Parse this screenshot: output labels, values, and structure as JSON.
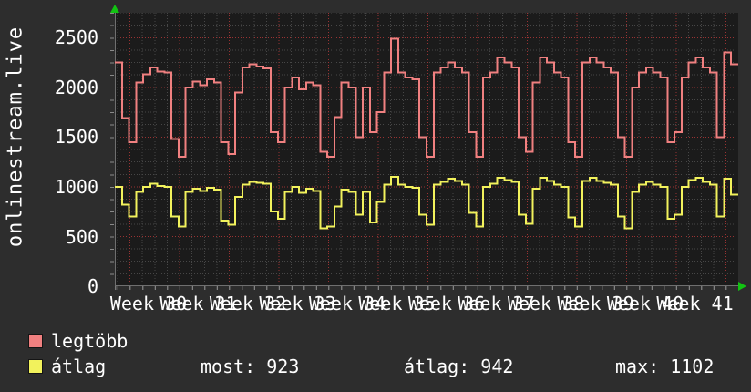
{
  "graph": {
    "vertical_title": "onlinestream.live"
  },
  "legend": {
    "series1_label": "legtöbb",
    "series2_label": "átlag",
    "stats": [
      "most: 923",
      "átlag: 942",
      "max: 1102"
    ]
  },
  "colors": {
    "background": "#2d2d2d",
    "plot_background": "#1b1b1b",
    "grid_minor": "#474747",
    "grid_major": "#993333",
    "axis": "#6f6f6f",
    "arrow": "#12c312",
    "text": "#ffffff",
    "series1": "#f08080",
    "series2": "#f2f25c"
  },
  "chart_data": {
    "type": "line",
    "style": "step-daily",
    "title": "onlinestream.live",
    "x_labels": [
      "Week 30",
      "Week 31",
      "Week 32",
      "Week 33",
      "Week 34",
      "Week 35",
      "Week 36",
      "Week 37",
      "Week 38",
      "Week 39",
      "Week 40",
      "Week 41"
    ],
    "y_ticks": [
      0,
      500,
      1000,
      1500,
      2000,
      2500
    ],
    "ylim": [
      0,
      2750
    ],
    "grid": true,
    "legend_position": "bottom-left",
    "stats": {
      "most": 923,
      "átlag": 942,
      "max": 1102
    },
    "series": [
      {
        "name": "legtöbb",
        "color": "#f08080",
        "values": [
          2250,
          1690,
          1450,
          2050,
          2130,
          2200,
          2160,
          2150,
          1480,
          1300,
          2000,
          2060,
          2020,
          2080,
          2050,
          1450,
          1330,
          1950,
          2200,
          2230,
          2210,
          2190,
          1550,
          1450,
          2000,
          2100,
          1980,
          2050,
          2020,
          1350,
          1300,
          1700,
          2050,
          2000,
          1500,
          2000,
          1550,
          1750,
          2150,
          2490,
          2150,
          2100,
          2080,
          1500,
          1300,
          2150,
          2200,
          2250,
          2200,
          2150,
          1550,
          1300,
          2100,
          2150,
          2300,
          2250,
          2200,
          1500,
          1350,
          2050,
          2300,
          2250,
          2150,
          2100,
          1450,
          1300,
          2250,
          2300,
          2250,
          2200,
          2150,
          1500,
          1300,
          2000,
          2150,
          2200,
          2150,
          2100,
          1450,
          1550,
          2100,
          2250,
          2300,
          2200,
          2150,
          1500,
          2350,
          2230
        ]
      },
      {
        "name": "átlag",
        "color": "#f2f25c",
        "values": [
          1000,
          820,
          700,
          950,
          1000,
          1030,
          1010,
          1000,
          700,
          600,
          950,
          980,
          960,
          990,
          970,
          660,
          620,
          900,
          1020,
          1050,
          1040,
          1030,
          750,
          680,
          950,
          1000,
          940,
          980,
          960,
          580,
          600,
          800,
          970,
          950,
          720,
          950,
          640,
          850,
          1020,
          1100,
          1020,
          1000,
          990,
          720,
          620,
          1020,
          1050,
          1080,
          1060,
          1020,
          740,
          600,
          1000,
          1030,
          1090,
          1070,
          1050,
          720,
          630,
          980,
          1090,
          1060,
          1020,
          1000,
          690,
          600,
          1060,
          1090,
          1060,
          1040,
          1020,
          700,
          580,
          950,
          1020,
          1050,
          1020,
          1000,
          680,
          720,
          1000,
          1070,
          1090,
          1050,
          1020,
          700,
          1080,
          923
        ]
      }
    ]
  }
}
